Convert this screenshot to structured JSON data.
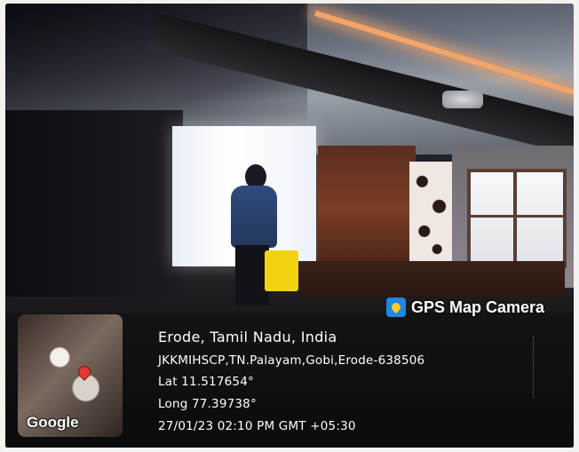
{
  "brand": {
    "label": "GPS Map Camera",
    "icon": "map-pin-icon",
    "icon_color": "#1e88e5"
  },
  "map_thumbnail": {
    "provider_label": "Google",
    "pin_icon": "map-pin-icon",
    "pin_color": "#e53935"
  },
  "location": {
    "title": "Erode, Tamil Nadu, India",
    "address": "JKKMIHSCP,TN.Palayam,Gobi,Erode-638506",
    "latitude": "Lat 11.517654°",
    "longitude": "Long 77.39738°",
    "timestamp": "27/01/23 02:10 PM GMT +05:30"
  }
}
